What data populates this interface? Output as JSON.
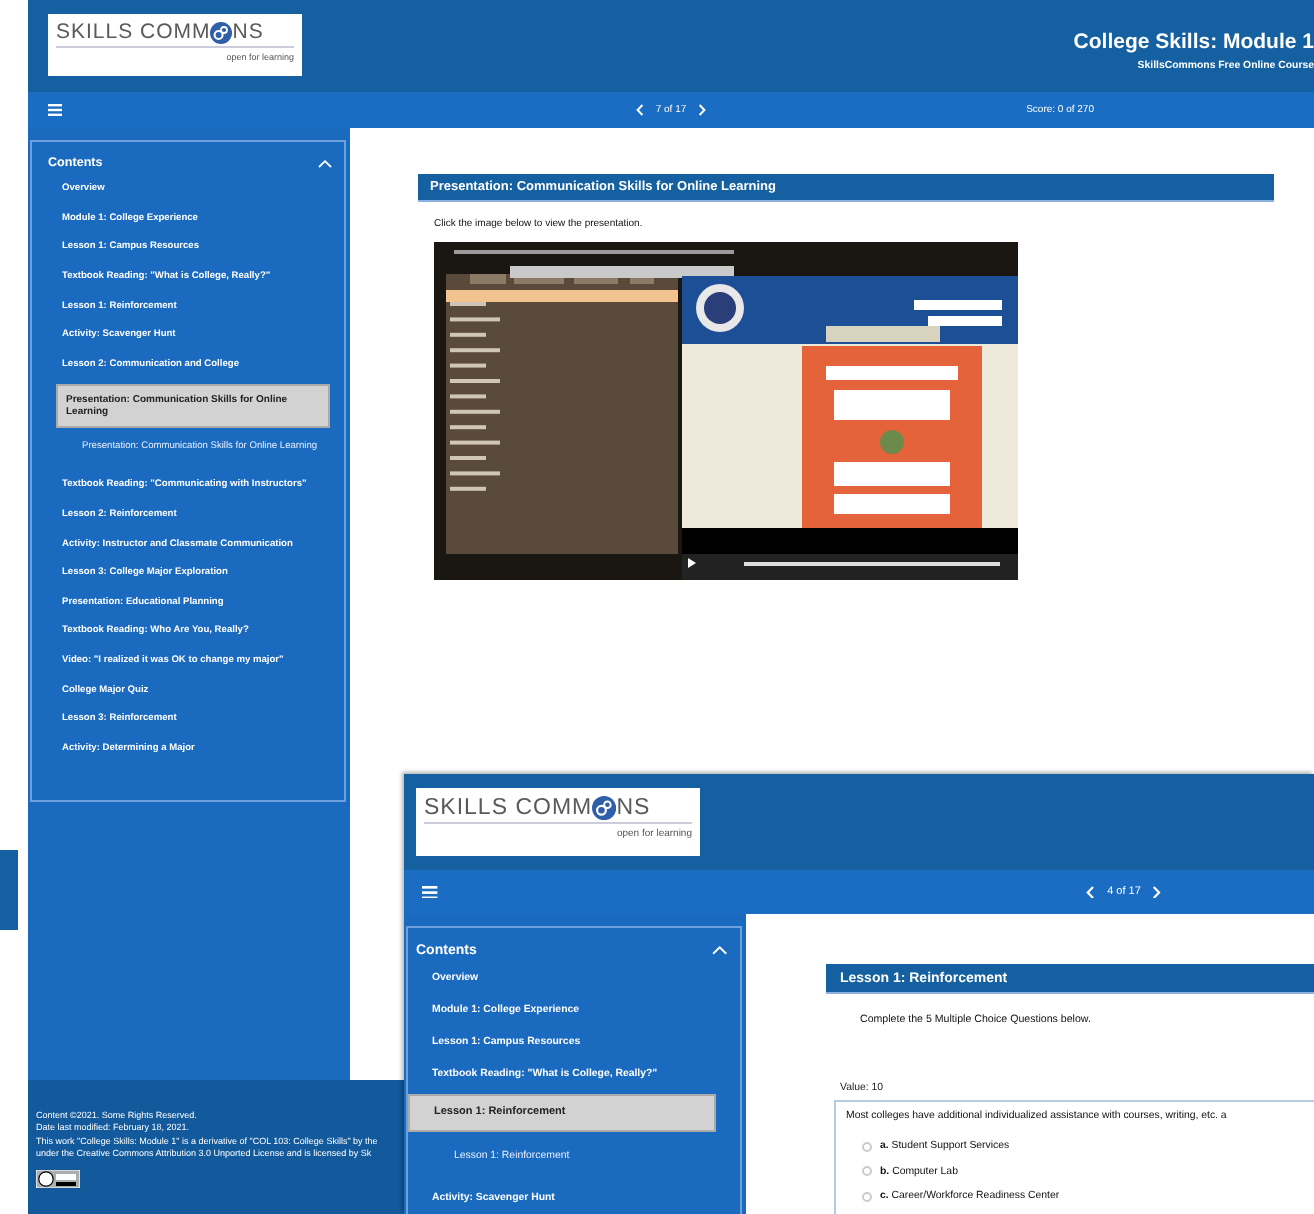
{
  "windows": [
    {
      "kind": "presentation",
      "logo": {
        "left": "SKILLS COMM",
        "right": "NS",
        "tagline": "open for learning"
      },
      "title": "College Skills: Module 1",
      "subtitle": "SkillsCommons Free Online Course",
      "pager": "7 of 17",
      "score": "Score: 0 of 270",
      "contents": {
        "heading": "Contents",
        "expanded": true,
        "items": [
          {
            "label": "Overview",
            "selected": false
          },
          {
            "label": "Module 1: College Experience",
            "selected": false
          },
          {
            "label": "Lesson 1: Campus Resources",
            "selected": false
          },
          {
            "label": "Textbook Reading: \"What is College, Really?\"",
            "selected": false
          },
          {
            "label": "Lesson 1: Reinforcement",
            "selected": false
          },
          {
            "label": "Activity: Scavenger Hunt",
            "selected": false
          },
          {
            "label": "Lesson 2: Communication and College",
            "selected": false
          },
          {
            "label": "Presentation: Communication Skills for Online Learning",
            "selected": true,
            "children": [
              {
                "label": "Presentation: Communication Skills for Online Learning",
                "selected": false
              }
            ]
          },
          {
            "label": "Textbook Reading: \"Communicating with Instructors\"",
            "selected": false
          },
          {
            "label": "Lesson 2: Reinforcement",
            "selected": false
          },
          {
            "label": "Activity: Instructor and Classmate Communication",
            "selected": false
          },
          {
            "label": "Lesson 3: College Major Exploration",
            "selected": false
          },
          {
            "label": "Presentation: Educational Planning",
            "selected": false
          },
          {
            "label": "Textbook Reading: Who Are You, Really?",
            "selected": false
          },
          {
            "label": "Video: \"I realized it was OK to change my major\"",
            "selected": false
          },
          {
            "label": "College Major Quiz",
            "selected": false
          },
          {
            "label": "Lesson 3: Reinforcement",
            "selected": false
          },
          {
            "label": "Activity: Determining a Major",
            "selected": false
          }
        ]
      },
      "panel_title": "Presentation: Communication Skills for Online Learning",
      "instruction": "Click the image below to view the presentation.",
      "footer": [
        "Content ©2021. Some Rights Reserved.",
        "Date last modified: February 18, 2021.",
        "This work \"College Skills: Module 1\" is a derivative of \"COL 103: College Skills\" by the",
        "under the Creative Commons Attribution 3.0 Unported License and is licensed by Sk"
      ]
    },
    {
      "kind": "quiz",
      "logo": {
        "left": "SKILLS COMM",
        "right": "NS",
        "tagline": "open for learning"
      },
      "pager": "4 of 17",
      "contents": {
        "heading": "Contents",
        "expanded": true,
        "items": [
          {
            "label": "Overview",
            "selected": false
          },
          {
            "label": "Module 1: College Experience",
            "selected": false
          },
          {
            "label": "Lesson 1: Campus Resources",
            "selected": false
          },
          {
            "label": "Textbook Reading: \"What is College, Really?\"",
            "selected": false
          },
          {
            "label": "Lesson 1: Reinforcement",
            "selected": true,
            "children": [
              {
                "label": "Lesson 1: Reinforcement",
                "selected": false
              }
            ]
          },
          {
            "label": "Activity: Scavenger Hunt",
            "selected": false
          }
        ]
      },
      "panel_title": "Lesson 1: Reinforcement",
      "instruction": "Complete the 5 Multiple Choice Questions below.",
      "value": "Value: 10",
      "question": "Most colleges have additional individualized assistance with courses, writing, etc. a",
      "options": [
        {
          "letter": "a.",
          "text": "Student Support Services",
          "selected": false
        },
        {
          "letter": "b.",
          "text": "Computer Lab",
          "selected": false
        },
        {
          "letter": "c.",
          "text": "Career/Workforce Readiness Center",
          "selected": false
        }
      ]
    }
  ]
}
